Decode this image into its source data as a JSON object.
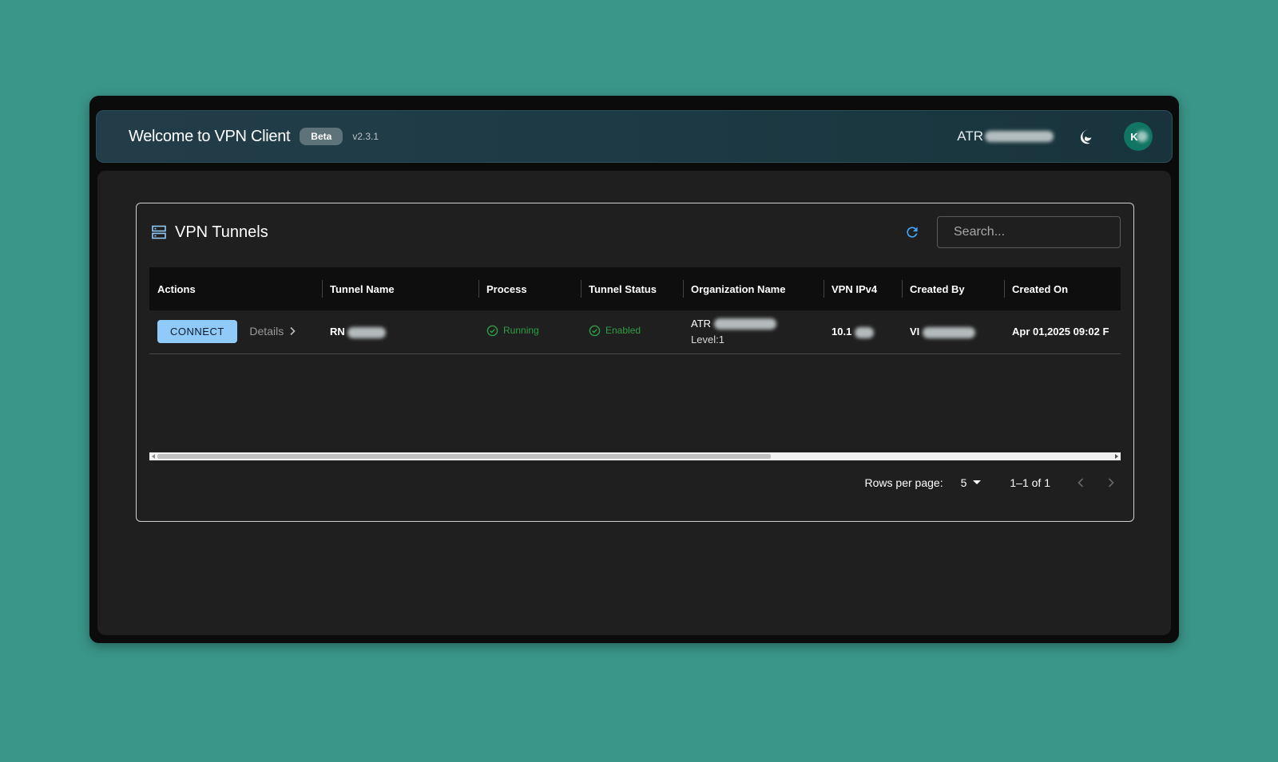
{
  "header": {
    "title": "Welcome to VPN Client",
    "badge": "Beta",
    "version": "v2.3.1",
    "org_prefix": "ATR",
    "avatar_initial": "K"
  },
  "card": {
    "title": "VPN Tunnels",
    "search_placeholder": "Search..."
  },
  "table": {
    "columns": [
      "Actions",
      "Tunnel Name",
      "Process",
      "Tunnel Status",
      "Organization Name",
      "VPN IPv4",
      "Created By",
      "Created On"
    ],
    "rows": [
      {
        "connect_label": "CONNECT",
        "details_label": "Details",
        "tunnel_name": "RN",
        "process": "Running",
        "tunnel_status": "Enabled",
        "org_name": "ATR",
        "org_level": "Level:1",
        "vpn_ipv4": "10.1",
        "created_by": "VI",
        "created_on": "Apr 01,2025 09:02 F"
      }
    ]
  },
  "pagination": {
    "rows_per_page_label": "Rows per page:",
    "rows_per_page_value": "5",
    "range": "1–1 of 1"
  },
  "colors": {
    "background": "#3a9689",
    "accent": "#90caf9",
    "success": "#2e9e43",
    "refresh": "#42a5f5"
  }
}
